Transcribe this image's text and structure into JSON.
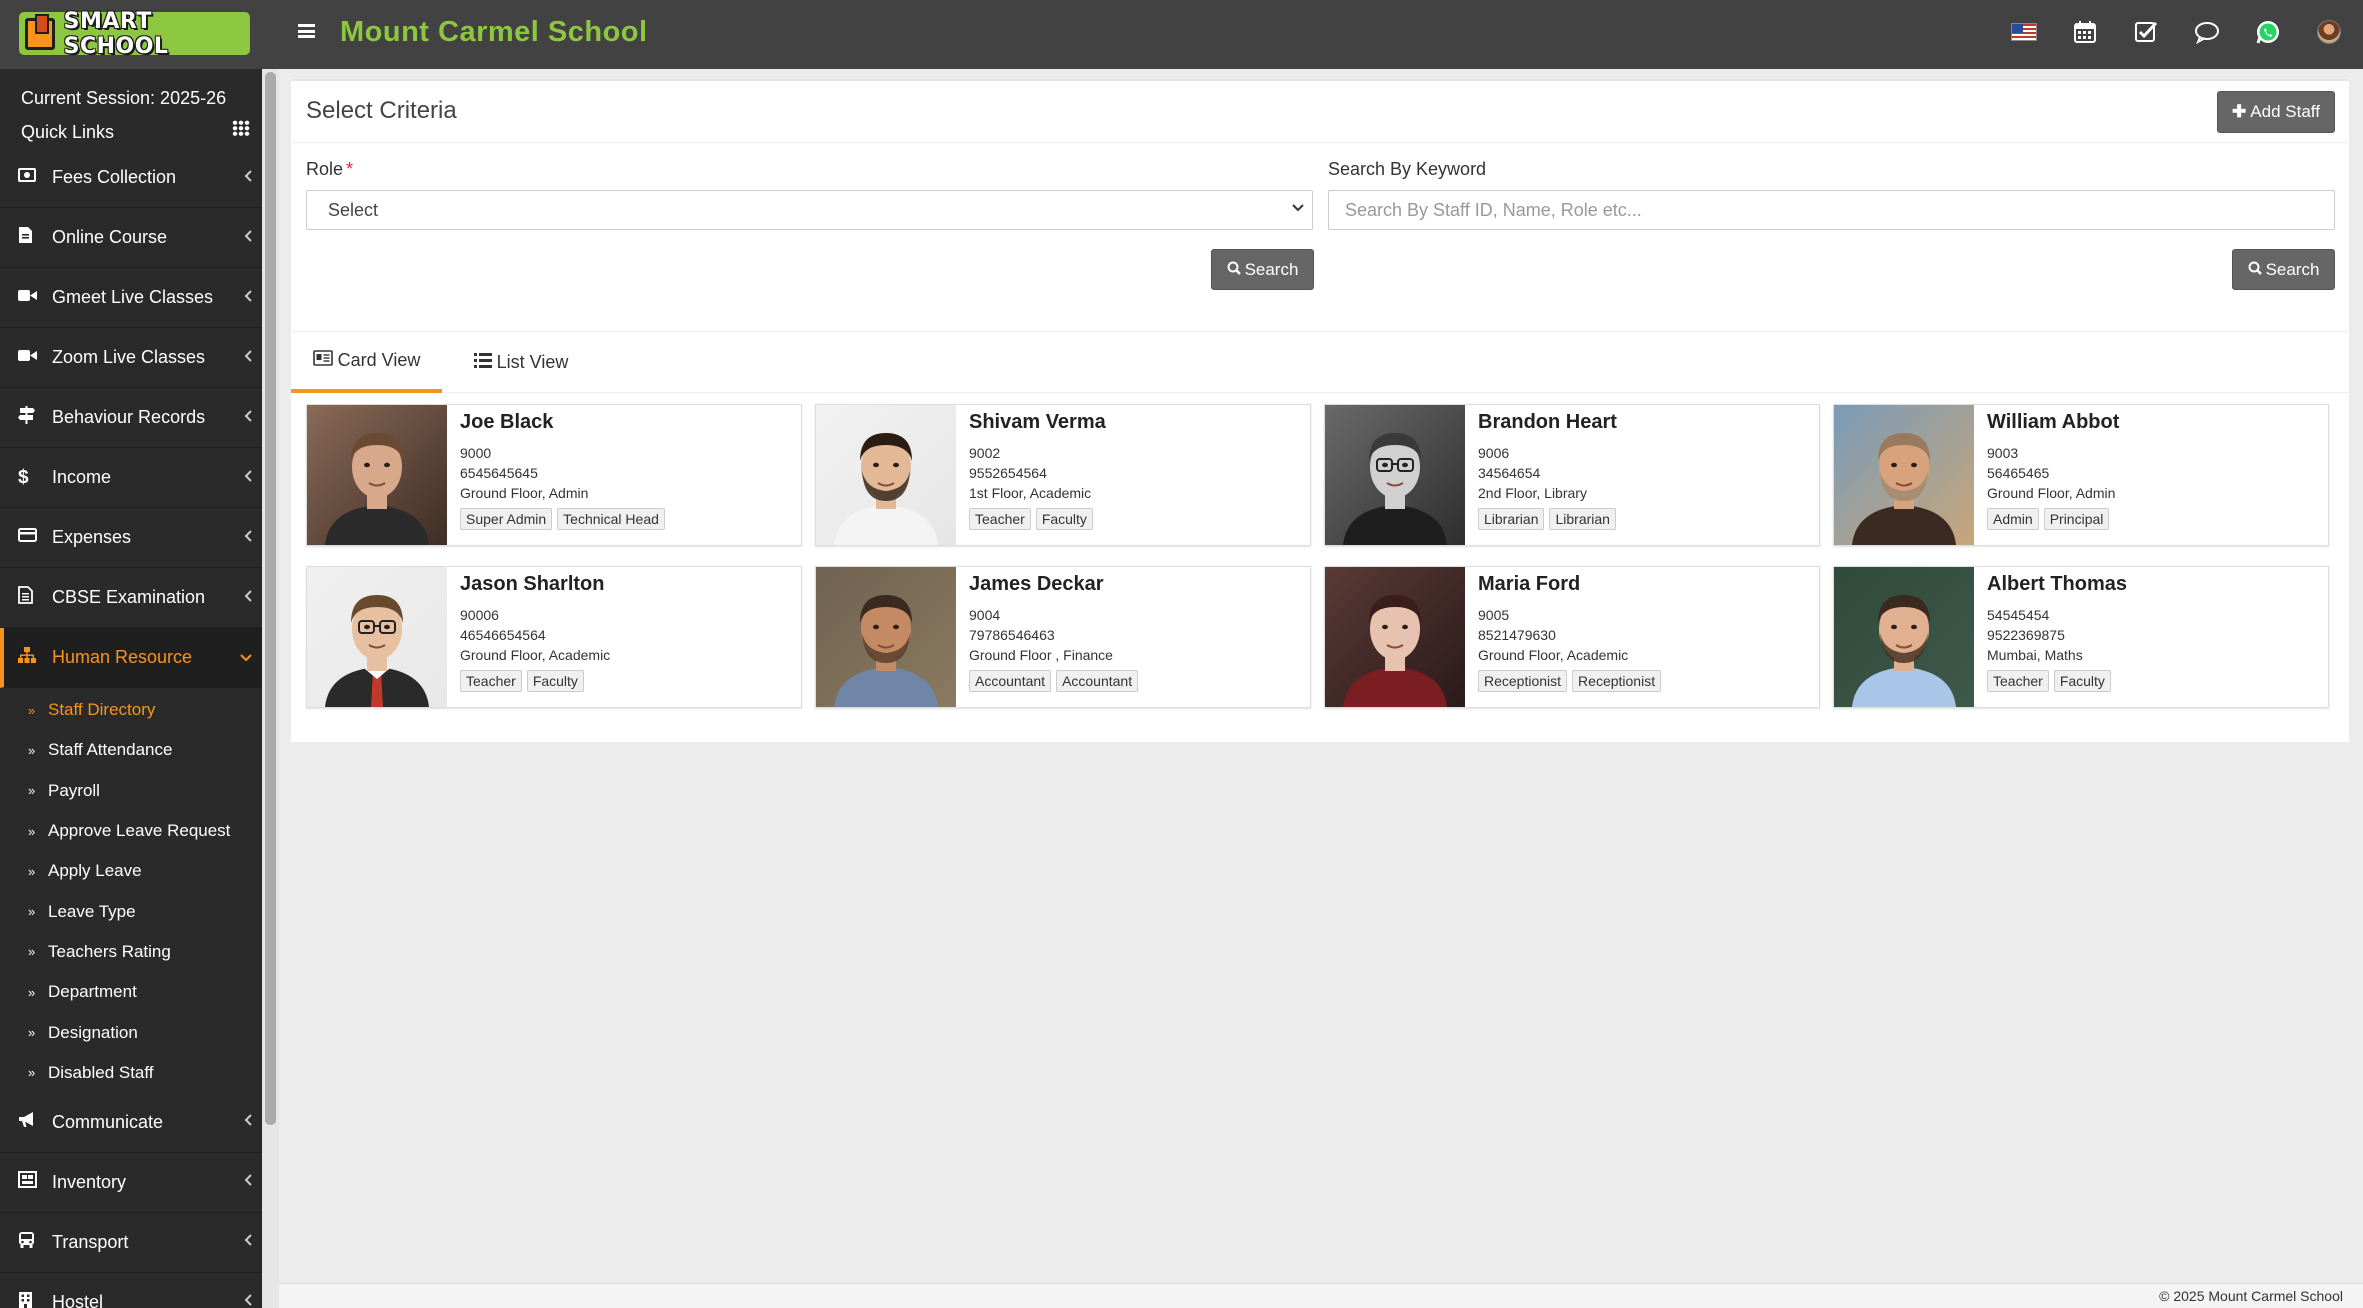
{
  "app": {
    "logo_text": "SMART SCHOOL",
    "school_name": "Mount Carmel School"
  },
  "topbar": {
    "icons": [
      "flag-us-icon",
      "calendar-icon",
      "task-check-icon",
      "chat-icon",
      "whatsapp-icon",
      "user-avatar"
    ]
  },
  "sidebar": {
    "session_label": "Current Session: 2025-26",
    "quick_links_label": "Quick Links",
    "menu_before": [
      {
        "label": "Fees Collection",
        "icon": "money-icon"
      },
      {
        "label": "Online Course",
        "icon": "file-icon"
      },
      {
        "label": "Gmeet Live Classes",
        "icon": "video-icon"
      },
      {
        "label": "Zoom Live Classes",
        "icon": "video-icon"
      },
      {
        "label": "Behaviour Records",
        "icon": "signpost-icon"
      },
      {
        "label": "Income",
        "icon": "dollar-icon"
      },
      {
        "label": "Expenses",
        "icon": "credit-card-icon"
      },
      {
        "label": "CBSE Examination",
        "icon": "document-icon"
      }
    ],
    "active_menu": {
      "label": "Human Resource",
      "icon": "sitemap-icon"
    },
    "submenu": [
      {
        "label": "Staff Directory",
        "active": true
      },
      {
        "label": "Staff Attendance"
      },
      {
        "label": "Payroll"
      },
      {
        "label": "Approve Leave Request"
      },
      {
        "label": "Apply Leave"
      },
      {
        "label": "Leave Type"
      },
      {
        "label": "Teachers Rating"
      },
      {
        "label": "Department"
      },
      {
        "label": "Designation"
      },
      {
        "label": "Disabled Staff"
      }
    ],
    "menu_after": [
      {
        "label": "Communicate",
        "icon": "bullhorn-icon"
      },
      {
        "label": "Inventory",
        "icon": "inventory-icon"
      },
      {
        "label": "Transport",
        "icon": "bus-icon"
      },
      {
        "label": "Hostel",
        "icon": "building-icon"
      }
    ]
  },
  "criteria": {
    "title": "Select Criteria",
    "add_staff_label": "Add Staff",
    "role_label": "Role",
    "role_required_mark": "*",
    "role_value": "Select",
    "keyword_label": "Search By Keyword",
    "keyword_placeholder": "Search By Staff ID, Name, Role etc...",
    "search_label": "Search"
  },
  "tabs": [
    {
      "label": "Card View",
      "active": true
    },
    {
      "label": "List View"
    }
  ],
  "staff": [
    {
      "name": "Joe Black",
      "id": "9000",
      "phone": "6545645645",
      "location": "Ground Floor, Admin",
      "tags": [
        "Super Admin",
        "Technical Head"
      ]
    },
    {
      "name": "Shivam Verma",
      "id": "9002",
      "phone": "9552654564",
      "location": "1st Floor, Academic",
      "tags": [
        "Teacher",
        "Faculty"
      ]
    },
    {
      "name": "Brandon Heart",
      "id": "9006",
      "phone": "34564654",
      "location": "2nd Floor, Library",
      "tags": [
        "Librarian",
        "Librarian"
      ]
    },
    {
      "name": "William Abbot",
      "id": "9003",
      "phone": "56465465",
      "location": "Ground Floor, Admin",
      "tags": [
        "Admin",
        "Principal"
      ]
    },
    {
      "name": "Jason Sharlton",
      "id": "90006",
      "phone": "46546654564",
      "location": "Ground Floor, Academic",
      "tags": [
        "Teacher",
        "Faculty"
      ]
    },
    {
      "name": "James Deckar",
      "id": "9004",
      "phone": "79786546463",
      "location": "Ground Floor , Finance",
      "tags": [
        "Accountant",
        "Accountant"
      ]
    },
    {
      "name": "Maria Ford",
      "id": "9005",
      "phone": "8521479630",
      "location": "Ground Floor, Academic",
      "tags": [
        "Receptionist",
        "Receptionist"
      ]
    },
    {
      "name": "Albert Thomas",
      "id": "54545454",
      "phone": "9522369875",
      "location": "Mumbai, Maths",
      "tags": [
        "Teacher",
        "Faculty"
      ]
    }
  ],
  "footer": {
    "text": "© 2025 Mount Carmel School"
  },
  "colors": {
    "accent": "#f7941d",
    "brand_green": "#8dc63f",
    "topbar_bg": "#424242",
    "sidebar_bg": "#2a2a2a"
  }
}
